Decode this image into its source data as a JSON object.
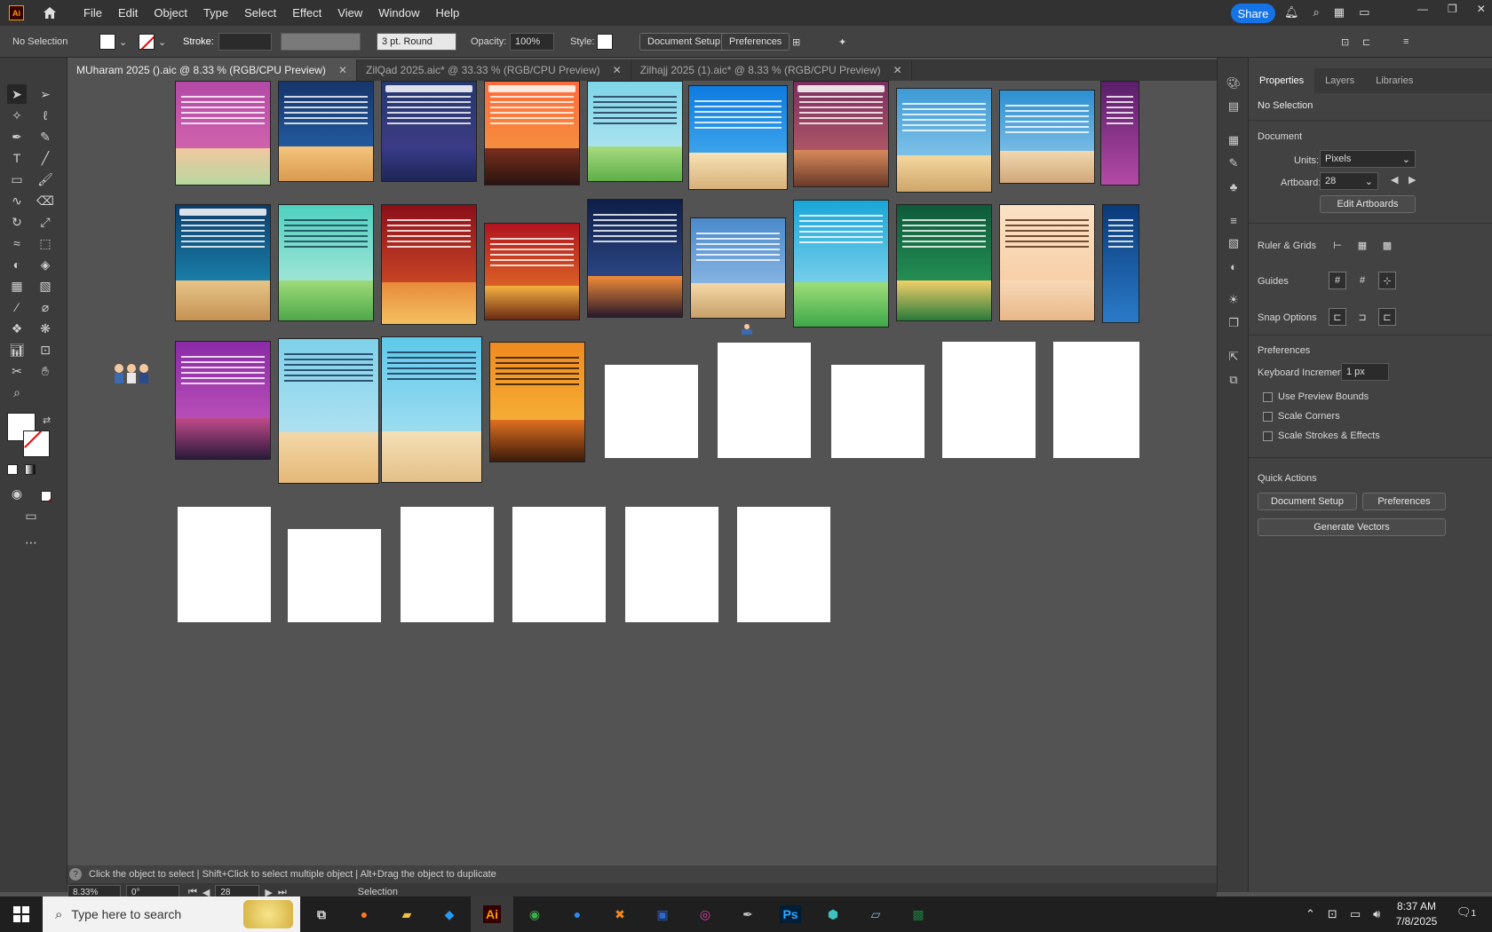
{
  "app": {
    "logo": "Ai",
    "menus": [
      "File",
      "Edit",
      "Object",
      "Type",
      "Select",
      "Effect",
      "View",
      "Window",
      "Help"
    ],
    "share_label": "Share"
  },
  "control": {
    "selection": "No Selection",
    "stroke_label": "Stroke:",
    "brush": "3 pt. Round",
    "opacity_label": "Opacity:",
    "opacity_value": "100%",
    "style_label": "Style:",
    "document_setup": "Document Setup",
    "preferences": "Preferences"
  },
  "tabs": [
    {
      "label": "MUharam 2025 ().aic @ 8.33 % (RGB/CPU Preview)",
      "active": true
    },
    {
      "label": "ZilQad 2025.aic* @ 33.33 % (RGB/CPU Preview)",
      "active": false
    },
    {
      "label": "Zilhajj 2025 (1).aic* @ 8.33 % (RGB/CPU Preview)",
      "active": false
    }
  ],
  "properties": {
    "tabs": [
      "Properties",
      "Layers",
      "Libraries"
    ],
    "selection": "No Selection",
    "document_heading": "Document",
    "units_label": "Units:",
    "units_value": "Pixels",
    "artboard_label": "Artboard:",
    "artboard_value": "28",
    "edit_artboards": "Edit Artboards",
    "ruler_grids": "Ruler & Grids",
    "guides": "Guides",
    "snap_options": "Snap Options",
    "preferences_heading": "Preferences",
    "keyboard_increment_label": "Keyboard Increment:",
    "keyboard_increment_value": "1 px",
    "use_preview_bounds": "Use Preview Bounds",
    "scale_corners": "Scale Corners",
    "scale_strokes": "Scale Strokes & Effects",
    "quick_actions": "Quick Actions",
    "qa_document_setup": "Document Setup",
    "qa_preferences": "Preferences",
    "qa_generate_vectors": "Generate Vectors"
  },
  "hint": "Click the object to select  |  Shift+Click to select multiple object  |  Alt+Drag the object to duplicate",
  "status": {
    "zoom": "8.33%",
    "rotation": "0°",
    "artboard": "28",
    "tool": "Selection"
  },
  "taskbar": {
    "search_placeholder": "Type here to search",
    "time": "8:37 AM",
    "date": "7/8/2025",
    "notifications": "1",
    "apps": [
      "Ai",
      "Ps"
    ]
  },
  "colors": {
    "accent": "#1473e6",
    "ai_brand": "#ff9a00"
  }
}
